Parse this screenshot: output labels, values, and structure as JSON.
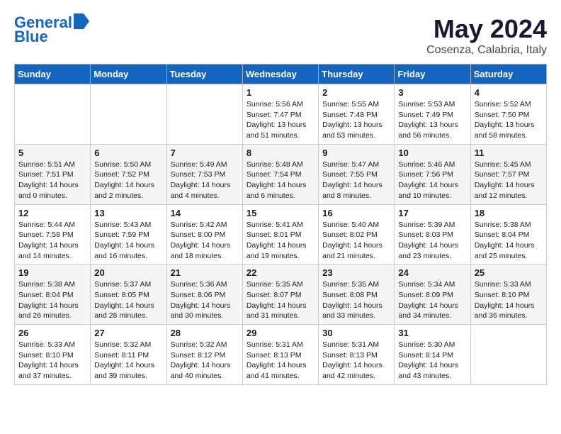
{
  "logo": {
    "line1": "General",
    "line2": "Blue"
  },
  "title": "May 2024",
  "subtitle": "Cosenza, Calabria, Italy",
  "weekdays": [
    "Sunday",
    "Monday",
    "Tuesday",
    "Wednesday",
    "Thursday",
    "Friday",
    "Saturday"
  ],
  "weeks": [
    [
      {
        "day": "",
        "info": ""
      },
      {
        "day": "",
        "info": ""
      },
      {
        "day": "",
        "info": ""
      },
      {
        "day": "1",
        "info": "Sunrise: 5:56 AM\nSunset: 7:47 PM\nDaylight: 13 hours\nand 51 minutes."
      },
      {
        "day": "2",
        "info": "Sunrise: 5:55 AM\nSunset: 7:48 PM\nDaylight: 13 hours\nand 53 minutes."
      },
      {
        "day": "3",
        "info": "Sunrise: 5:53 AM\nSunset: 7:49 PM\nDaylight: 13 hours\nand 56 minutes."
      },
      {
        "day": "4",
        "info": "Sunrise: 5:52 AM\nSunset: 7:50 PM\nDaylight: 13 hours\nand 58 minutes."
      }
    ],
    [
      {
        "day": "5",
        "info": "Sunrise: 5:51 AM\nSunset: 7:51 PM\nDaylight: 14 hours\nand 0 minutes."
      },
      {
        "day": "6",
        "info": "Sunrise: 5:50 AM\nSunset: 7:52 PM\nDaylight: 14 hours\nand 2 minutes."
      },
      {
        "day": "7",
        "info": "Sunrise: 5:49 AM\nSunset: 7:53 PM\nDaylight: 14 hours\nand 4 minutes."
      },
      {
        "day": "8",
        "info": "Sunrise: 5:48 AM\nSunset: 7:54 PM\nDaylight: 14 hours\nand 6 minutes."
      },
      {
        "day": "9",
        "info": "Sunrise: 5:47 AM\nSunset: 7:55 PM\nDaylight: 14 hours\nand 8 minutes."
      },
      {
        "day": "10",
        "info": "Sunrise: 5:46 AM\nSunset: 7:56 PM\nDaylight: 14 hours\nand 10 minutes."
      },
      {
        "day": "11",
        "info": "Sunrise: 5:45 AM\nSunset: 7:57 PM\nDaylight: 14 hours\nand 12 minutes."
      }
    ],
    [
      {
        "day": "12",
        "info": "Sunrise: 5:44 AM\nSunset: 7:58 PM\nDaylight: 14 hours\nand 14 minutes."
      },
      {
        "day": "13",
        "info": "Sunrise: 5:43 AM\nSunset: 7:59 PM\nDaylight: 14 hours\nand 16 minutes."
      },
      {
        "day": "14",
        "info": "Sunrise: 5:42 AM\nSunset: 8:00 PM\nDaylight: 14 hours\nand 18 minutes."
      },
      {
        "day": "15",
        "info": "Sunrise: 5:41 AM\nSunset: 8:01 PM\nDaylight: 14 hours\nand 19 minutes."
      },
      {
        "day": "16",
        "info": "Sunrise: 5:40 AM\nSunset: 8:02 PM\nDaylight: 14 hours\nand 21 minutes."
      },
      {
        "day": "17",
        "info": "Sunrise: 5:39 AM\nSunset: 8:03 PM\nDaylight: 14 hours\nand 23 minutes."
      },
      {
        "day": "18",
        "info": "Sunrise: 5:38 AM\nSunset: 8:04 PM\nDaylight: 14 hours\nand 25 minutes."
      }
    ],
    [
      {
        "day": "19",
        "info": "Sunrise: 5:38 AM\nSunset: 8:04 PM\nDaylight: 14 hours\nand 26 minutes."
      },
      {
        "day": "20",
        "info": "Sunrise: 5:37 AM\nSunset: 8:05 PM\nDaylight: 14 hours\nand 28 minutes."
      },
      {
        "day": "21",
        "info": "Sunrise: 5:36 AM\nSunset: 8:06 PM\nDaylight: 14 hours\nand 30 minutes."
      },
      {
        "day": "22",
        "info": "Sunrise: 5:35 AM\nSunset: 8:07 PM\nDaylight: 14 hours\nand 31 minutes."
      },
      {
        "day": "23",
        "info": "Sunrise: 5:35 AM\nSunset: 8:08 PM\nDaylight: 14 hours\nand 33 minutes."
      },
      {
        "day": "24",
        "info": "Sunrise: 5:34 AM\nSunset: 8:09 PM\nDaylight: 14 hours\nand 34 minutes."
      },
      {
        "day": "25",
        "info": "Sunrise: 5:33 AM\nSunset: 8:10 PM\nDaylight: 14 hours\nand 36 minutes."
      }
    ],
    [
      {
        "day": "26",
        "info": "Sunrise: 5:33 AM\nSunset: 8:10 PM\nDaylight: 14 hours\nand 37 minutes."
      },
      {
        "day": "27",
        "info": "Sunrise: 5:32 AM\nSunset: 8:11 PM\nDaylight: 14 hours\nand 39 minutes."
      },
      {
        "day": "28",
        "info": "Sunrise: 5:32 AM\nSunset: 8:12 PM\nDaylight: 14 hours\nand 40 minutes."
      },
      {
        "day": "29",
        "info": "Sunrise: 5:31 AM\nSunset: 8:13 PM\nDaylight: 14 hours\nand 41 minutes."
      },
      {
        "day": "30",
        "info": "Sunrise: 5:31 AM\nSunset: 8:13 PM\nDaylight: 14 hours\nand 42 minutes."
      },
      {
        "day": "31",
        "info": "Sunrise: 5:30 AM\nSunset: 8:14 PM\nDaylight: 14 hours\nand 43 minutes."
      },
      {
        "day": "",
        "info": ""
      }
    ]
  ]
}
